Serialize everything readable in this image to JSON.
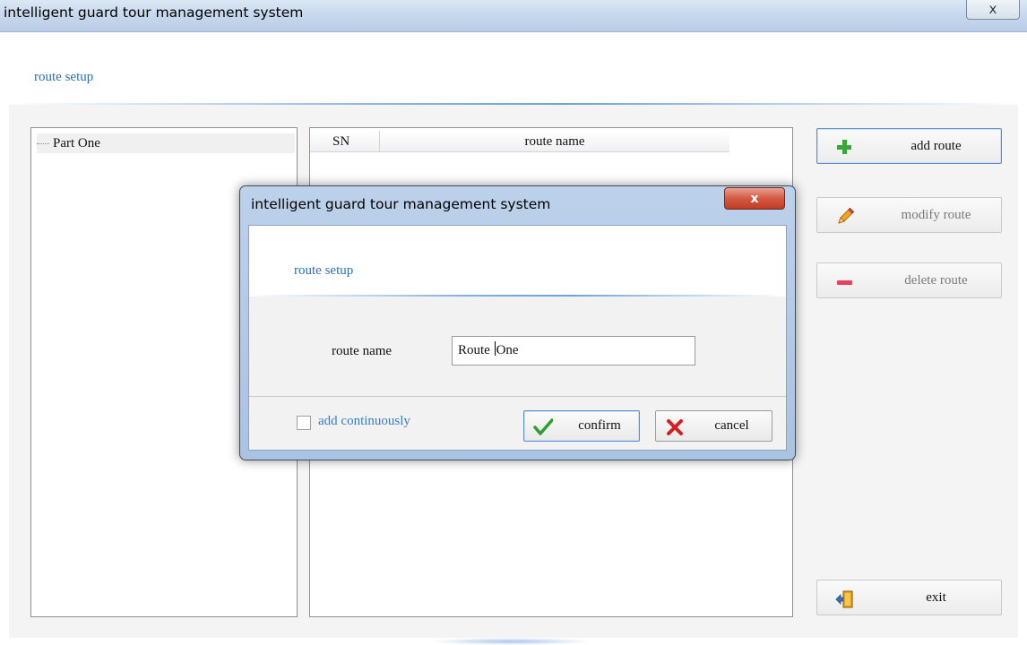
{
  "window": {
    "title": "intelligent guard tour management system",
    "close_label": "x",
    "section_title": "route setup"
  },
  "tree": {
    "items": [
      {
        "label": "Part One"
      }
    ]
  },
  "route_table": {
    "columns": [
      "SN",
      "route name"
    ],
    "rows": []
  },
  "actions": {
    "add_route": {
      "label": "add route",
      "icon": "plus-icon",
      "color": "#3aa53a"
    },
    "modify_route": {
      "label": "modify route",
      "icon": "pencil-icon",
      "enabled": false
    },
    "delete_route": {
      "label": "delete route",
      "icon": "minus-icon",
      "color": "#e0455c",
      "enabled": false
    },
    "exit": {
      "label": "exit",
      "icon": "exit-door-icon"
    }
  },
  "dialog": {
    "title": "intelligent guard tour management system",
    "close_label": "x",
    "section_title": "route setup",
    "route_name_label": "route name",
    "route_name_value": "Route One",
    "add_continuously_label": "add continuously",
    "add_continuously_checked": false,
    "confirm_label": "confirm",
    "cancel_label": "cancel"
  },
  "colors": {
    "accent_blue": "#2f6fb3",
    "confirm_green": "#2e9e2e",
    "cancel_red": "#d42020"
  }
}
